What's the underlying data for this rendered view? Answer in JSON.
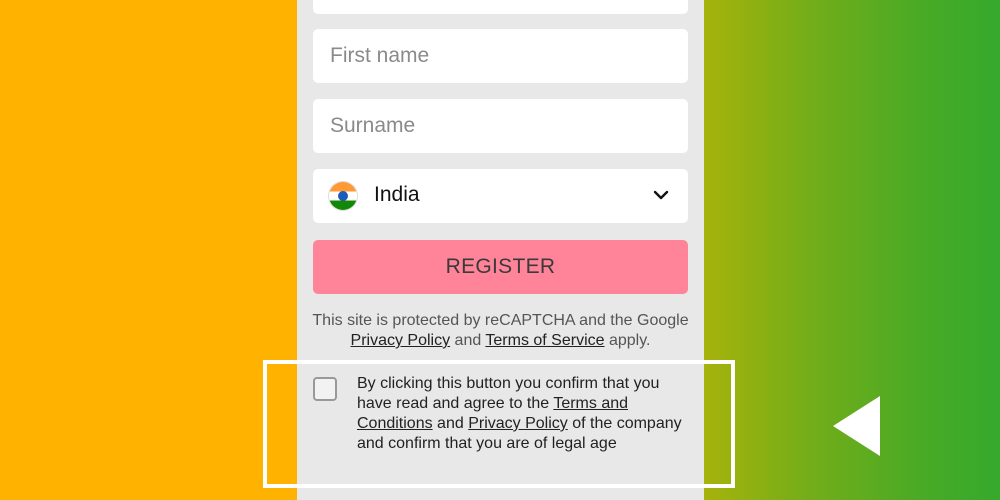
{
  "form": {
    "top_field_placeholder": "",
    "first_name_placeholder": "First name",
    "surname_placeholder": "Surname",
    "country": {
      "selected": "India",
      "flag_icon": "india-flag-icon",
      "dropdown_icon": "chevron-down-icon"
    },
    "register_label": "REGISTER",
    "recaptcha": {
      "text_before": "This site is protected by reCAPTCHA and the Google ",
      "privacy_link": "Privacy Policy",
      "text_middle": " and ",
      "terms_link": "Terms of Service",
      "text_after": " apply."
    },
    "consent": {
      "checked": false,
      "text_before": "By clicking this button you confirm that you have read and agree to the ",
      "terms_link": "Terms and Conditions",
      "text_middle": " and ",
      "privacy_link": "Privacy Policy",
      "text_after": " of the company and confirm that you are of legal age"
    }
  },
  "overlay": {
    "highlight_box": "consent-highlight",
    "arrow_icon": "left-pointing-triangle-icon"
  },
  "colors": {
    "register_button": "#ff8499",
    "panel_background": "#e8e8e8",
    "left_background": "#ffb300",
    "right_background_start": "#a6b30b",
    "right_background_end": "#35a92c"
  }
}
